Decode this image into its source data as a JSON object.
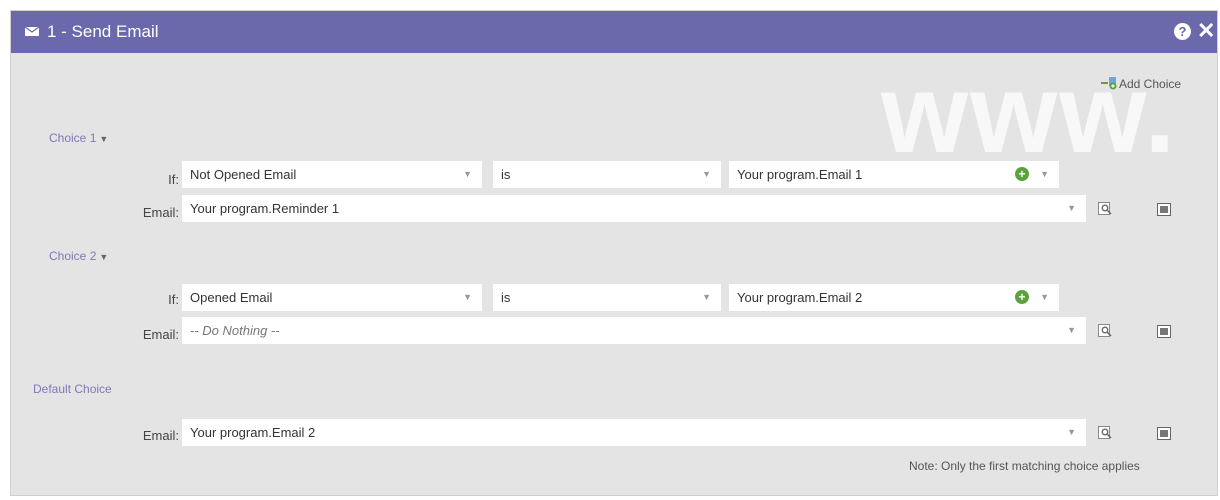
{
  "dialog": {
    "title": "1 - Send Email",
    "help_icon": "?",
    "close_icon": "✕",
    "watermark": "www."
  },
  "add_choice_label": "Add Choice",
  "choices": [
    {
      "label": "Choice 1",
      "if_label": "If:",
      "condition": "Not Opened Email",
      "operator": "is",
      "value": "Your program.Email 1",
      "email_label": "Email:",
      "email": "Your program.Reminder 1"
    },
    {
      "label": "Choice 2",
      "if_label": "If:",
      "condition": "Opened Email",
      "operator": "is",
      "value": "Your program.Email 2",
      "email_label": "Email:",
      "email": "-- Do Nothing --"
    }
  ],
  "default_choice": {
    "label": "Default Choice",
    "email_label": "Email:",
    "email": "Your program.Email 2"
  },
  "note": "Note: Only the first matching choice applies",
  "colors": {
    "header": "#6b68ac",
    "panel": "#e4e4e4",
    "link": "#7e7ab3",
    "add": "#5aa33c"
  }
}
